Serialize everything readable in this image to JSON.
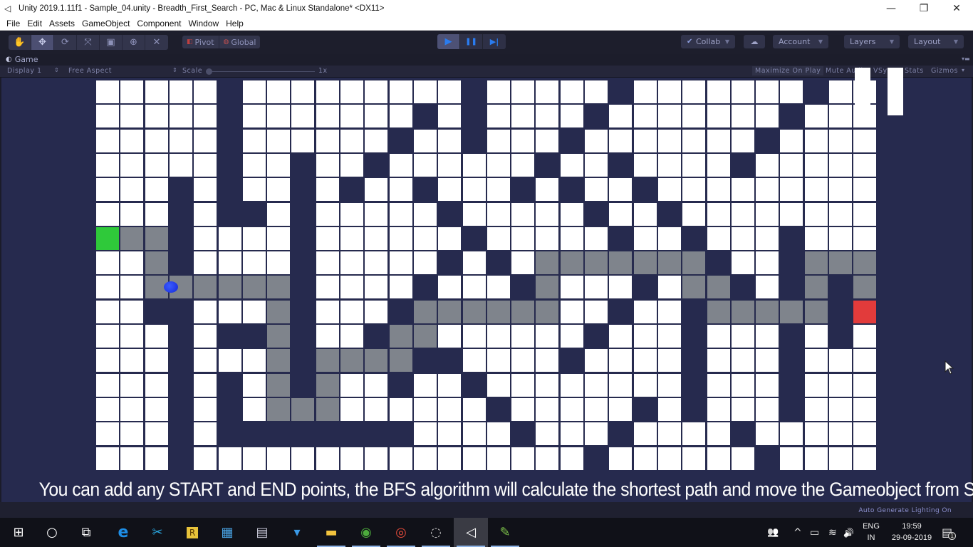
{
  "window": {
    "title": "Unity 2019.1.11f1 - Sample_04.unity - Breadth_First_Search - PC, Mac & Linux Standalone* <DX11>",
    "controls": [
      "minimize",
      "restore",
      "close"
    ]
  },
  "menu": [
    "File",
    "Edit",
    "Assets",
    "GameObject",
    "Component",
    "Window",
    "Help"
  ],
  "toolbar": {
    "transform_tools": [
      {
        "name": "hand-tool",
        "icon": "✋"
      },
      {
        "name": "move-tool",
        "icon": "✥",
        "active": true
      },
      {
        "name": "rotate-tool",
        "icon": "⟳"
      },
      {
        "name": "scale-tool",
        "icon": "⤧"
      },
      {
        "name": "rect-tool",
        "icon": "▣"
      },
      {
        "name": "transform-tool",
        "icon": "⊕"
      },
      {
        "name": "custom-tool",
        "icon": "✕"
      }
    ],
    "pivot_label": "Pivot",
    "global_label": "Global",
    "play_controls": [
      {
        "name": "play-button",
        "icon": "▶",
        "active": true
      },
      {
        "name": "pause-button",
        "icon": "❚❚"
      },
      {
        "name": "step-button",
        "icon": "▶|"
      }
    ],
    "collab_label": "Collab",
    "cloud_icon": "☁",
    "account_label": "Account",
    "layers_label": "Layers",
    "layout_label": "Layout"
  },
  "game_panel": {
    "tab_label": "Game",
    "display": "Display 1",
    "aspect": "Free Aspect",
    "scale_label": "Scale",
    "scale_value": "1x",
    "options": [
      "Maximize On Play",
      "Mute Audio",
      "VSync",
      "Stats",
      "Gizmos"
    ]
  },
  "grid": {
    "cols": 32,
    "rows": 16,
    "legend": {
      "W": "walkable",
      "D": "obstacle",
      "G": "path",
      "S": "start",
      "E": "end"
    },
    "colors": {
      "walkable": "#ffffff",
      "obstacle": "#262a4e",
      "path": "#7f848c",
      "start": "#2fc93a",
      "end": "#e23b3b",
      "agent": "#1f3cf0"
    },
    "cells": [
      "WWWWWDWWWWWWWWWDWWWWWDWWWWWWWDWW",
      "WWWWWDWWWWWWWDWDWWWWDWWWWWWWDWWW",
      "WWWWWDWWWWWWDWWDWWWDWWWWWWWDWWWW",
      "WWWWWDWWDWWDWWWWWWDWWDWWWWDWWWWW",
      "WWWDWDWWDWDWWDWWWDWDWWDWWWWWWWWW",
      "WWWDWDDWDWWWWWDWWWWWDWWDWWWWWWWW",
      "SGGDWWWWDWWWWWWDWWWWWDWWDWWWDWWW",
      "WWGDWWWWDWWWWWDWDWGGGGGGGDWWDGGG",
      "WWGGGGGGDWWWWDWWWDGWWWDWGGDWDGDG",
      "WWDDWWWGDWWWDGGGGGGWWDWWDGGGGGDE",
      "WWWDWDDGDWWDGGWWWWWWDWWWDWWWDWDW",
      "WWWDWWWGDGGGGDDWWWWDWWWWDWWWDWWW",
      "WWWDWDWGDGWWDWWDWWWWWWWWDWWWDWWW",
      "WWWDWDWGGGWWWWWWDWWWWWDWDWWWDWWW",
      "WWWDWDDDDDDDDWWWWDWWWDWWWWDWWWWW",
      "WWWDWWWWWWWWWWWWWWWWDWWWWWWDWWWW"
    ],
    "agent_position": {
      "row": 8,
      "col": 2.6
    }
  },
  "caption": "You can add any START and END points, the BFS algorithm will calculate the shortest path and move the Gameobject from START to END point.",
  "status": {
    "lighting": "Auto Generate Lighting On"
  },
  "taskbar": {
    "apps": [
      {
        "name": "start",
        "icon": "⊞"
      },
      {
        "name": "search",
        "icon": "○"
      },
      {
        "name": "task-view",
        "icon": "⧉"
      },
      {
        "name": "edge",
        "icon": "e"
      },
      {
        "name": "tools",
        "icon": "✂"
      },
      {
        "name": "rider",
        "icon": "R"
      },
      {
        "name": "app-blue",
        "icon": "▦"
      },
      {
        "name": "app-monitor",
        "icon": "▤"
      },
      {
        "name": "app-dev",
        "icon": "▾"
      },
      {
        "name": "file-explorer",
        "icon": "▬"
      },
      {
        "name": "download-manager",
        "icon": "◉"
      },
      {
        "name": "chrome",
        "icon": "◎"
      },
      {
        "name": "obs",
        "icon": "◌"
      },
      {
        "name": "unity",
        "icon": "◁"
      },
      {
        "name": "notepad",
        "icon": "✎"
      }
    ],
    "tray": {
      "people_icon": "👥",
      "chevron": "^",
      "battery_icon": "▭",
      "wifi_icon": "≋",
      "volume_icon": "🔊",
      "lang_top": "ENG",
      "lang_bottom": "IN",
      "time": "19:59",
      "date": "29-09-2019",
      "notification_count": "1"
    }
  }
}
